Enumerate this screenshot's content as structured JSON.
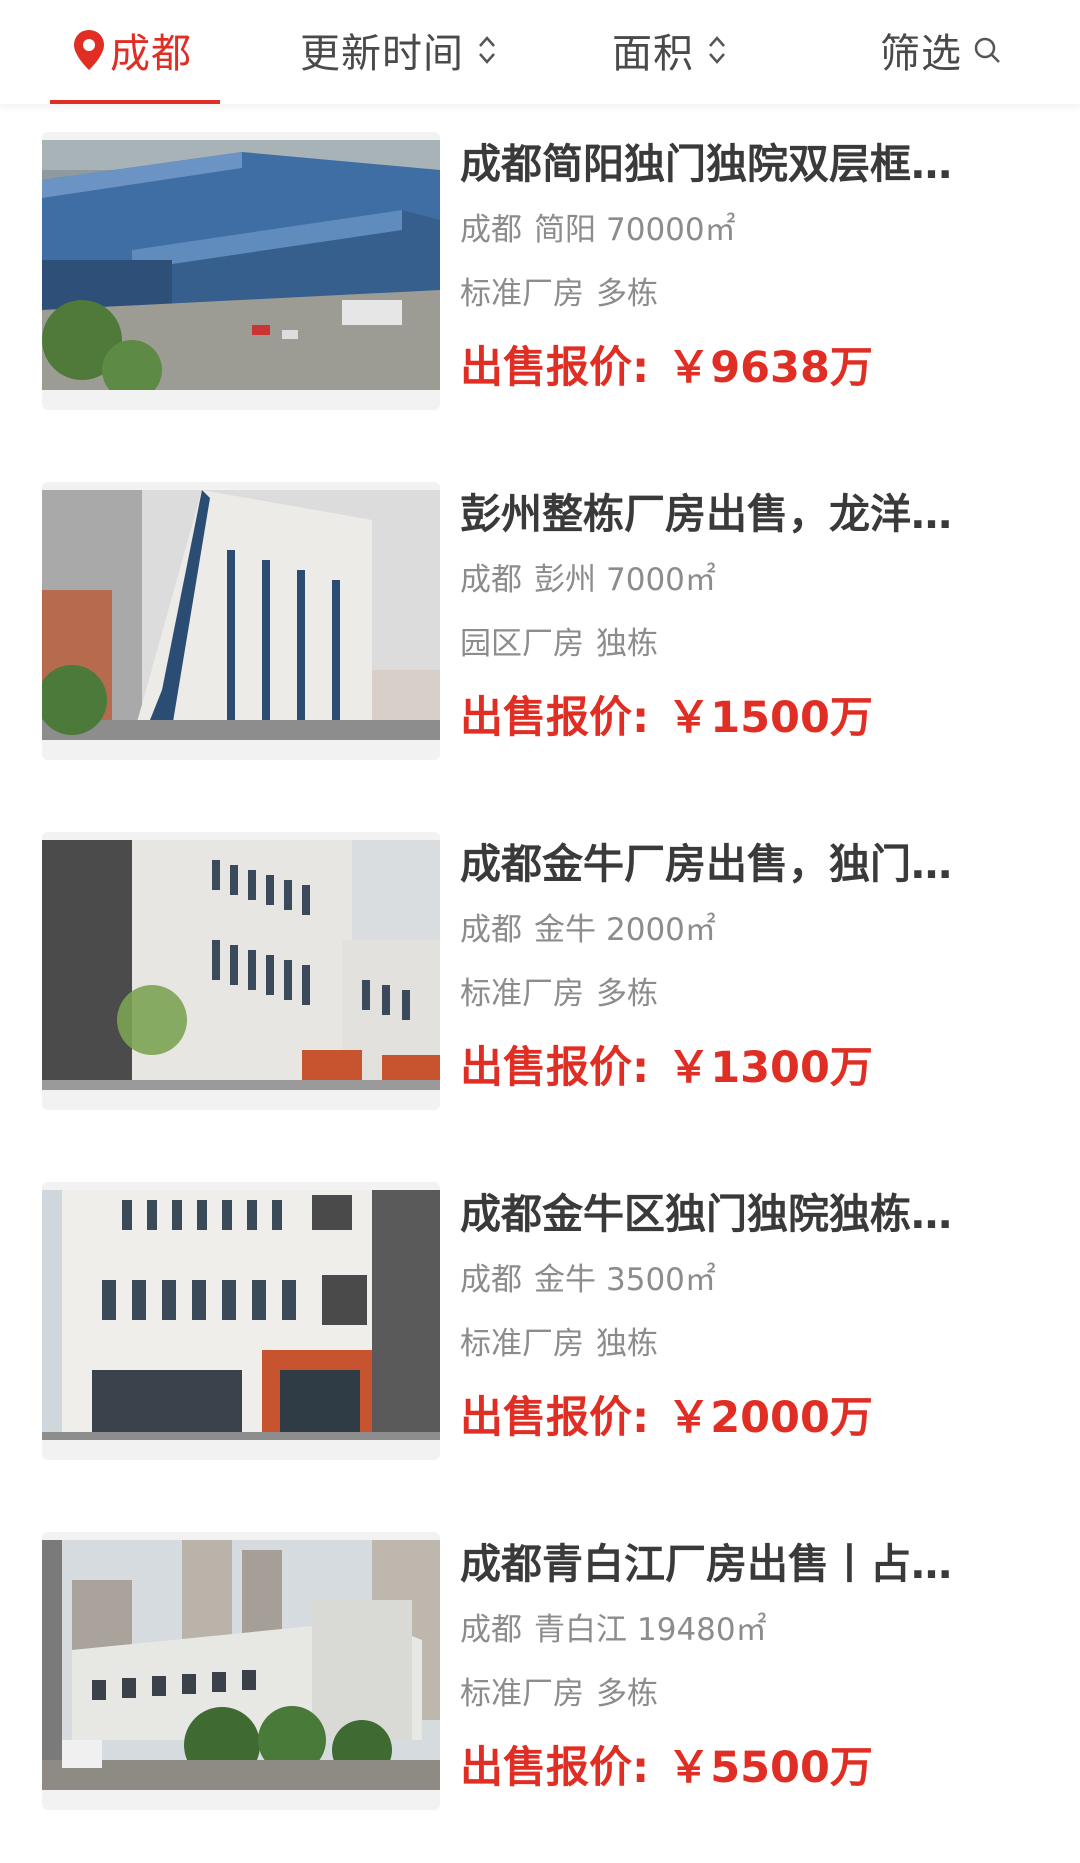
{
  "filter_bar": {
    "city": "成都",
    "sort_update": "更新时间",
    "sort_area": "面积",
    "filter": "筛选",
    "accent_color": "#e02e24",
    "icons": [
      "location-pin-icon",
      "sort-arrows-icon",
      "sort-arrows-icon",
      "search-icon"
    ]
  },
  "listings": [
    {
      "title": "成都简阳独门独院双层框…",
      "city": "成都",
      "district": "简阳",
      "area": "70000㎡",
      "type": "标准厂房",
      "building": "多栋",
      "price_label": "出售报价:",
      "price": "￥9638万",
      "image": "aerial-warehouse-photo"
    },
    {
      "title": "彭州整栋厂房出售，龙洋…",
      "city": "成都",
      "district": "彭州",
      "area": "7000㎡",
      "type": "园区厂房",
      "building": "独栋",
      "price_label": "出售报价:",
      "price": "￥1500万",
      "image": "tall-factory-building-photo"
    },
    {
      "title": "成都金牛厂房出售，独门…",
      "city": "成都",
      "district": "金牛",
      "area": "2000㎡",
      "type": "标准厂房",
      "building": "多栋",
      "price_label": "出售报价:",
      "price": "￥1300万",
      "image": "office-building-photo"
    },
    {
      "title": "成都金牛区独门独院独栋…",
      "city": "成都",
      "district": "金牛",
      "area": "3500㎡",
      "type": "标准厂房",
      "building": "独栋",
      "price_label": "出售报价:",
      "price": "￥2000万",
      "image": "modern-building-photo"
    },
    {
      "title": "成都青白江厂房出售丨占…",
      "city": "成都",
      "district": "青白江",
      "area": "19480㎡",
      "type": "标准厂房",
      "building": "多栋",
      "price_label": "出售报价:",
      "price": "￥5500万",
      "image": "old-factory-photo"
    }
  ]
}
